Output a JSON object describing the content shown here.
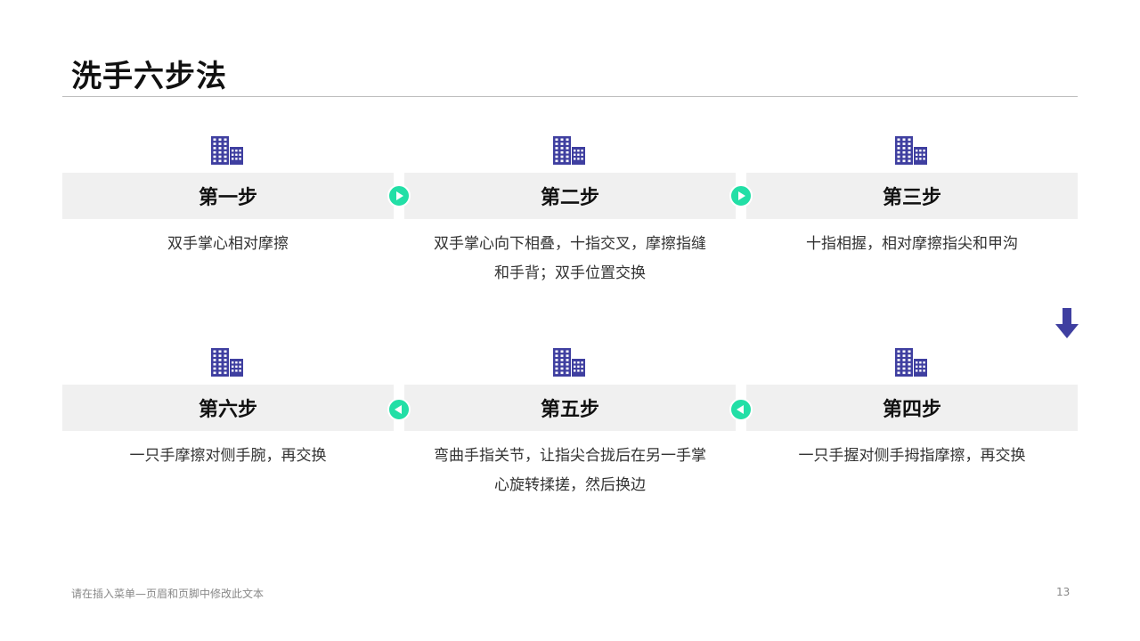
{
  "title": "洗手六步法",
  "colors": {
    "icon": "#3f3fa0",
    "connector": "#22dfa6",
    "arrow": "#3f3fa0",
    "bar": "#f0f0f0"
  },
  "steps": [
    {
      "id": 1,
      "label": "第一步",
      "lines": [
        "双手掌心相对摩擦"
      ],
      "icon": "building-icon"
    },
    {
      "id": 2,
      "label": "第二步",
      "lines": [
        "双手掌心向下相叠，十指交叉，摩擦指缝",
        "和手背；双手位置交换"
      ],
      "icon": "building-icon"
    },
    {
      "id": 3,
      "label": "第三步",
      "lines": [
        "十指相握，相对摩擦指尖和甲沟"
      ],
      "icon": "building-icon"
    },
    {
      "id": 4,
      "label": "第四步",
      "lines": [
        "一只手握对侧手拇指摩擦，再交换"
      ],
      "icon": "building-icon"
    },
    {
      "id": 5,
      "label": "第五步",
      "lines": [
        "弯曲手指关节，让指尖合拢后在另一手掌",
        "心旋转揉搓，然后换边"
      ],
      "icon": "building-icon"
    },
    {
      "id": 6,
      "label": "第六步",
      "lines": [
        "一只手摩擦对侧手腕，再交换"
      ],
      "icon": "building-icon"
    }
  ],
  "footer": {
    "text": "请在插入菜单—页眉和页脚中修改此文本",
    "page": "13"
  }
}
